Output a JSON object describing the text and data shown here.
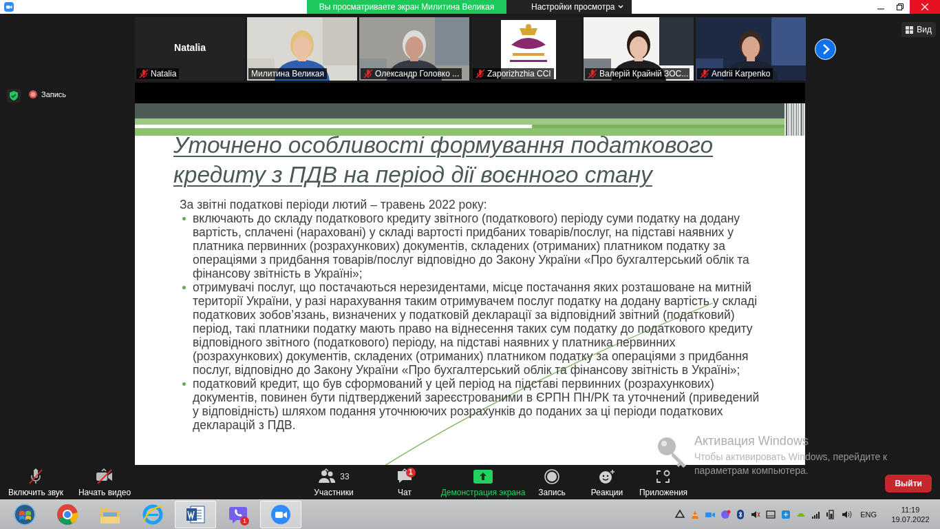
{
  "title_bar": {
    "share_banner": "Вы просматриваете экран Милитина Великая",
    "view_options": "Настройки просмотра"
  },
  "participants": [
    {
      "kind": "avatar",
      "display_name": "Natalia",
      "name": "Natalia",
      "muted": true,
      "speaking": false
    },
    {
      "kind": "video",
      "name": "Милитина Великая",
      "muted": false,
      "speaking": true
    },
    {
      "kind": "video",
      "name": "Олександр Головко ...",
      "muted": true,
      "speaking": false
    },
    {
      "kind": "logo",
      "name": "Zaporizhzhia CCI",
      "muted": true,
      "speaking": false
    },
    {
      "kind": "video",
      "name": "Валерій Крайній ЗОС...",
      "muted": true,
      "speaking": false
    },
    {
      "kind": "video",
      "name": "Andrii Karpenko",
      "muted": true,
      "speaking": false
    }
  ],
  "view_button": {
    "label": "Вид"
  },
  "recording": {
    "label": "Запись"
  },
  "slide": {
    "title": "Уточнено особливості формування податкового кредиту з ПДВ на період дії воєнного стану",
    "intro": "За звітні податкові періоди лютий – травень 2022 року:",
    "bullets": [
      "включають до складу податкового кредиту звітного (податкового) періоду суми податку на додану вартість, сплачені (нараховані) у складі вартості придбаних товарів/послуг, на підставі наявних у платника первинних (розрахункових) документів, складених (отриманих) платником податку за операціями з придбання товарів/послуг відповідно до Закону України «Про бухгалтерський облік та фінансову звітність в Україні»;",
      "отримувачі послуг, що постачаються нерезидентами, місце постачання яких розташоване на митній території України, у разі нарахування таким отримувачем послуг податку на додану вартість у складі податкових зобов’язань, визначених у податковій декларації за відповідний звітний (податковий) період, такі платники податку мають право на віднесення таких сум податку до податкового кредиту відповідного звітного (податкового) періоду, на підставі наявних у платника первинних (розрахункових) документів, складених (отриманих) платником податку за операціями з придбання послуг, відповідно до Закону України «Про бухгалтерський облік та фінансову звітність в Україні»;",
      "податковий кредит, що був сформований у цей період на підставі первинних (розрахункових) документів, повинен бути підтверджений зареєстрованими в ЄРПН ПН/РК та уточнений (приведений у відповідність) шляхом подання уточнюючих розрахунків до поданих за ці періоди податкових декларацій з ПДВ."
    ]
  },
  "toolbar": {
    "left": [
      {
        "kind": "audio",
        "label": "Включить звук",
        "off": true,
        "has_menu": true
      },
      {
        "kind": "video",
        "label": "Начать видео",
        "off": true,
        "has_menu": true
      }
    ],
    "center": [
      {
        "kind": "participants",
        "label": "Участники",
        "count": "33",
        "has_menu": true
      },
      {
        "kind": "chat",
        "label": "Чат",
        "badge": "1",
        "has_menu": true
      },
      {
        "kind": "share",
        "label": "Демонстрация экрана",
        "has_menu": false
      },
      {
        "kind": "record",
        "label": "Запись",
        "has_menu": false
      },
      {
        "kind": "reactions",
        "label": "Реакции",
        "has_menu": false
      },
      {
        "kind": "apps",
        "label": "Приложения",
        "has_menu": false
      }
    ],
    "leave_button": "Выйти"
  },
  "activation_notice": {
    "title": "Активация Windows",
    "text": "Чтобы активировать Windows, перейдите к параметрам компьютера."
  },
  "taskbar": {
    "apps": [
      {
        "kind": "start",
        "active": false
      },
      {
        "kind": "chrome",
        "active": false
      },
      {
        "kind": "explorer",
        "active": false
      },
      {
        "kind": "ie",
        "active": false
      },
      {
        "kind": "word",
        "active": true
      },
      {
        "kind": "viber",
        "active": false,
        "badge": "1"
      },
      {
        "kind": "zoom",
        "active": true
      }
    ],
    "language": "ENG",
    "time": "11:19",
    "date": "19.07.2022"
  }
}
